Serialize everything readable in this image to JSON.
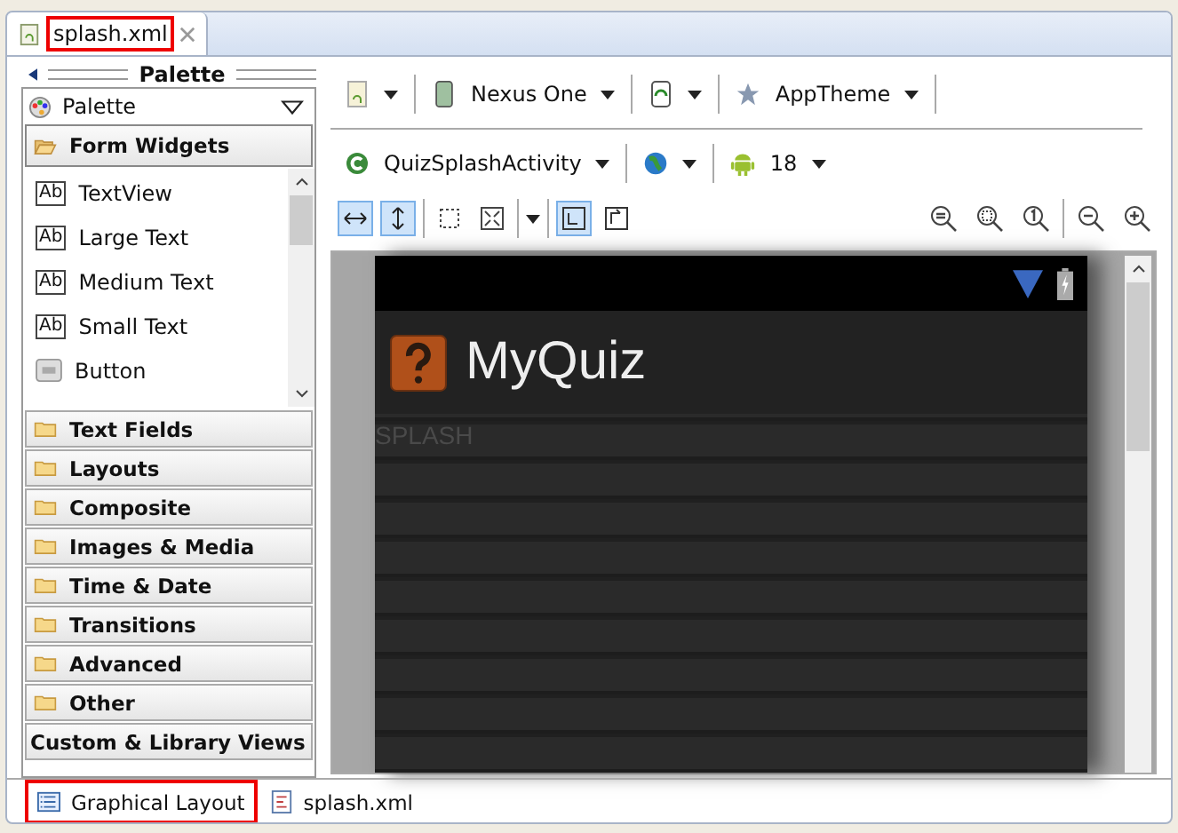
{
  "editor_tabs": [
    {
      "label": "splash.xml",
      "selected": true
    }
  ],
  "palette": {
    "title": "Palette",
    "selector": "Palette",
    "open_category": {
      "label": "Form Widgets",
      "expanded": true,
      "items": [
        {
          "label": "TextView",
          "kind": "text",
          "icon_text": "Ab"
        },
        {
          "label": "Large Text",
          "kind": "text",
          "icon_text": "Ab"
        },
        {
          "label": "Medium Text",
          "kind": "text",
          "icon_text": "Ab"
        },
        {
          "label": "Small Text",
          "kind": "text",
          "icon_text": "Ab"
        },
        {
          "label": "Button",
          "kind": "button"
        }
      ]
    },
    "categories": [
      {
        "label": "Text Fields",
        "kind": "folder"
      },
      {
        "label": "Layouts",
        "kind": "folder"
      },
      {
        "label": "Composite",
        "kind": "folder"
      },
      {
        "label": "Images & Media",
        "kind": "folder"
      },
      {
        "label": "Time & Date",
        "kind": "folder"
      },
      {
        "label": "Transitions",
        "kind": "folder"
      },
      {
        "label": "Advanced",
        "kind": "folder"
      },
      {
        "label": "Other",
        "kind": "folder"
      },
      {
        "label": "Custom & Library Views",
        "kind": "plain"
      }
    ]
  },
  "toolbar_1": [
    {
      "kind": "file"
    },
    {
      "kind": "device",
      "label": "Nexus One"
    },
    {
      "kind": "orientation"
    },
    {
      "kind": "theme",
      "label": "AppTheme"
    }
  ],
  "toolbar_2": [
    {
      "kind": "activity",
      "label": "QuizSplashActivity"
    },
    {
      "kind": "locale"
    },
    {
      "kind": "api",
      "label": "18"
    }
  ],
  "toolbar_3": [
    {
      "kind": "fit-width",
      "selected": true
    },
    {
      "kind": "fit-height",
      "selected": true
    },
    {
      "kind": "select",
      "selected": false
    },
    {
      "kind": "expand",
      "selected": false
    },
    {
      "kind": "layout-a",
      "selected": true
    },
    {
      "kind": "layout-b",
      "selected": false
    }
  ],
  "preview": {
    "app_title": "MyQuiz",
    "body_text": "SPLASH"
  },
  "bottom_tabs": [
    {
      "label": "Graphical Layout",
      "kind": "layout",
      "selected": true
    },
    {
      "label": "splash.xml",
      "kind": "xml",
      "selected": false
    }
  ]
}
